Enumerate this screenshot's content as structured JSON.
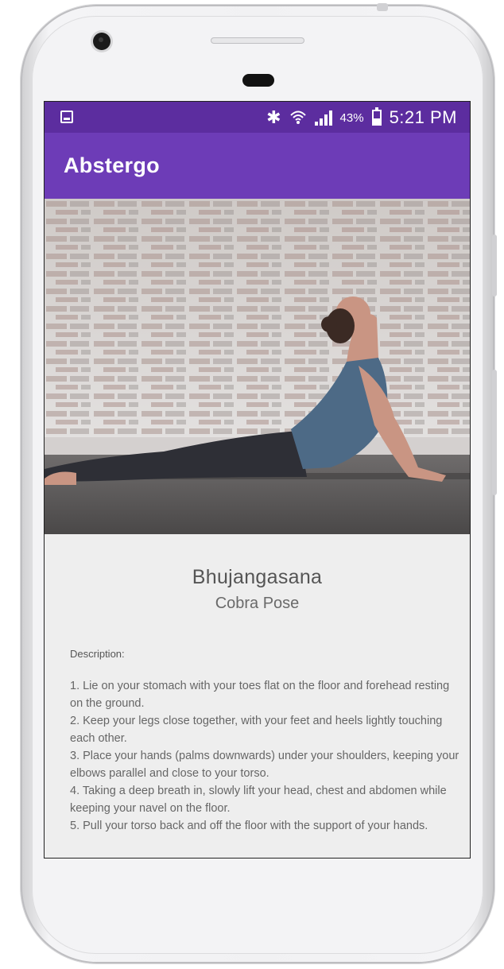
{
  "status_bar": {
    "battery_percent": "43%",
    "time": "5:21 PM",
    "icons": [
      "image-notification-icon",
      "bluetooth-icon",
      "wifi-icon",
      "signal-icon",
      "battery-icon"
    ]
  },
  "app_bar": {
    "title": "Abstergo",
    "color": "#6d3cb7",
    "status_color": "#5c2d9f"
  },
  "hero_image": {
    "description_icon": "yoga-cobra-pose-photo"
  },
  "pose": {
    "sanskrit_name": "Bhujangasana",
    "english_name": "Cobra Pose"
  },
  "description": {
    "label": "Description:",
    "steps": [
      "1. Lie on your stomach with your toes flat on the floor and forehead resting on the ground.",
      "2. Keep your legs close together, with your feet and heels lightly touching each other.",
      "3. Place your hands (palms downwards) under your shoulders, keeping your elbows parallel and close to your torso.",
      "4. Taking a deep breath in, slowly lift your head, chest and abdomen while keeping your navel on the floor.",
      "5. Pull your torso back and off the floor with the support of your hands."
    ]
  }
}
